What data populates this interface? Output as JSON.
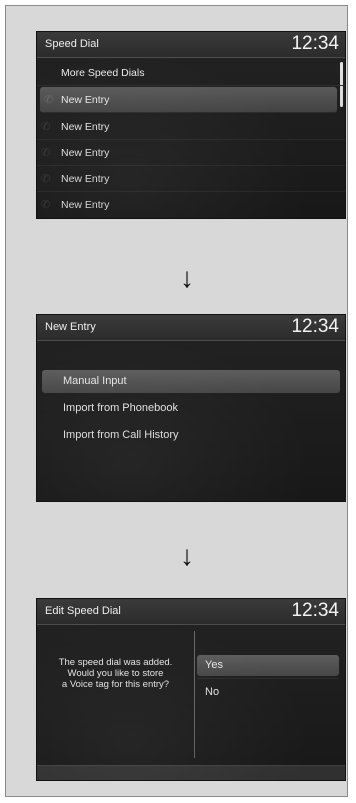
{
  "screen1": {
    "title": "Speed Dial",
    "clock": "12:34",
    "items": [
      {
        "label": "More Speed Dials"
      },
      {
        "label": "New Entry"
      },
      {
        "label": "New Entry"
      },
      {
        "label": "New Entry"
      },
      {
        "label": "New Entry"
      },
      {
        "label": "New Entry"
      }
    ],
    "selected_index": 1
  },
  "arrows": {
    "down": "↓"
  },
  "screen2": {
    "title": "New Entry",
    "clock": "12:34",
    "items": [
      {
        "label": "Manual Input"
      },
      {
        "label": "Import from Phonebook"
      },
      {
        "label": "Import from Call History"
      }
    ],
    "selected_index": 0
  },
  "screen3": {
    "title": "Edit Speed Dial",
    "clock": "12:34",
    "message_lines": [
      "The speed dial was added.",
      "Would you like to store",
      "a Voice tag for this entry?"
    ],
    "choices": [
      {
        "label": "Yes"
      },
      {
        "label": "No"
      }
    ],
    "selected_index": 0
  },
  "icons": {
    "phone": "phone-icon"
  }
}
